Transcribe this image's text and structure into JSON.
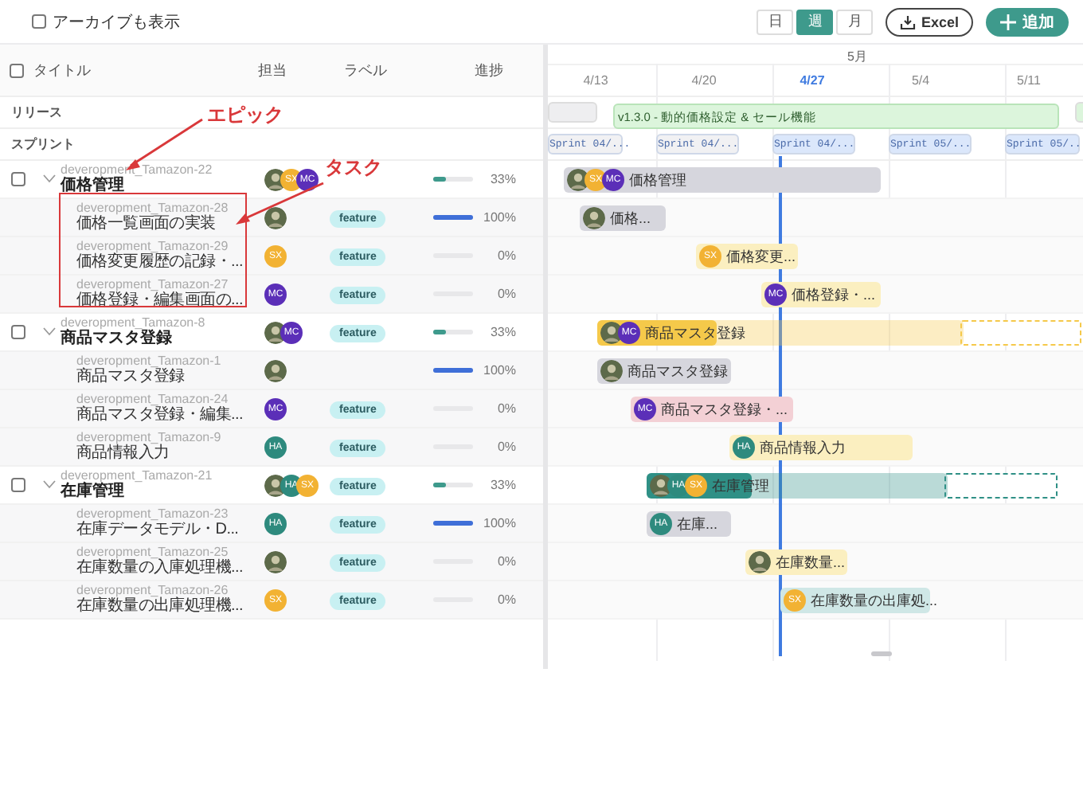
{
  "toolbar": {
    "archive_checkbox": {
      "label": "アーカイブも表示",
      "checked": false
    },
    "view_modes": [
      {
        "label": "日",
        "selected": false
      },
      {
        "label": "週",
        "selected": true
      },
      {
        "label": "月",
        "selected": false
      }
    ],
    "export_button": "Excel",
    "add_button": "追加"
  },
  "header_checkbox": {
    "checked": false
  },
  "columns": [
    "タイトル",
    "担当",
    "ラベル",
    "進捗"
  ],
  "timeline": {
    "month": "5月",
    "today_line": true,
    "weeks": [
      {
        "label": "4/13",
        "current": false
      },
      {
        "label": "4/20",
        "current": false
      },
      {
        "label": "4/27",
        "current": true
      },
      {
        "label": "5/4",
        "current": false
      },
      {
        "label": "5/11",
        "current": false
      }
    ]
  },
  "release_row": {
    "label": "リリース",
    "releases": [
      {
        "kind": "cut",
        "color": "#eeeef0"
      },
      {
        "kind": "bar",
        "label": "v1.3.0 - 動的価格設定 & セール機能",
        "color": "#dcf5dc"
      },
      {
        "kind": "cut",
        "color": "#dcf5dc"
      }
    ]
  },
  "sprint_row": {
    "label": "スプリント",
    "sprints": [
      {
        "label": "Sprint 04/...",
        "color": "#f1f1f3"
      },
      {
        "label": "Sprint 04/...",
        "color": "#f1f1f3"
      },
      {
        "label": "Sprint 04/...",
        "color": "#dbe7fb"
      },
      {
        "label": "Sprint 05/...",
        "color": "#dbe7fb"
      },
      {
        "label": "Sprint 05/...",
        "color": "#dbe7fb"
      }
    ]
  },
  "items": [
    {
      "kind": "epic",
      "id": "deveropment_Tamazon-22",
      "title": "価格管理",
      "checked": false,
      "expanded": true,
      "assignees": [
        {
          "kind": "photo"
        },
        {
          "kind": "initials",
          "text": "SX",
          "color": "#f2b233"
        },
        {
          "kind": "initials",
          "text": "MC",
          "color": "#5b2fb8"
        }
      ],
      "progress": {
        "level": 0.33,
        "reading": "33%"
      },
      "bar": {
        "label": "価格管理",
        "color": "#d6d6dd",
        "assignees": [
          {
            "kind": "photo"
          },
          {
            "kind": "initials",
            "text": "SX",
            "color": "#f2b233"
          },
          {
            "kind": "initials",
            "text": "MC",
            "color": "#5b2fb8"
          }
        ]
      },
      "children": [
        {
          "kind": "task",
          "id": "deveropment_Tamazon-28",
          "title": "価格一覧画面の実装",
          "assignees": [
            {
              "kind": "photo"
            }
          ],
          "tag": "feature",
          "progress": {
            "level": 1,
            "reading": "100%"
          },
          "bar": {
            "label": "価格...",
            "color": "#d6d6dd",
            "assignees": [
              {
                "kind": "photo"
              }
            ]
          }
        },
        {
          "kind": "task",
          "id": "deveropment_Tamazon-29",
          "title": "価格変更履歴の記録・...",
          "assignees": [
            {
              "kind": "initials",
              "text": "SX",
              "color": "#f2b233"
            }
          ],
          "tag": "feature",
          "progress": {
            "level": 0,
            "reading": "0%"
          },
          "bar": {
            "label": "価格変更...",
            "color": "#fbefc0",
            "assignees": [
              {
                "kind": "initials",
                "text": "SX",
                "color": "#f2b233"
              }
            ]
          }
        },
        {
          "kind": "task",
          "id": "deveropment_Tamazon-27",
          "title": "価格登録・編集画面の...",
          "assignees": [
            {
              "kind": "initials",
              "text": "MC",
              "color": "#5b2fb8"
            }
          ],
          "tag": "feature",
          "progress": {
            "level": 0,
            "reading": "0%"
          },
          "bar": {
            "label": "価格登録・...",
            "color": "#fbefc0",
            "assignees": [
              {
                "kind": "initials",
                "text": "MC",
                "color": "#5b2fb8"
              }
            ]
          }
        }
      ]
    },
    {
      "kind": "epic",
      "id": "deveropment_Tamazon-8",
      "title": "商品マスタ登録",
      "checked": false,
      "expanded": true,
      "assignees": [
        {
          "kind": "photo"
        },
        {
          "kind": "initials",
          "text": "MC",
          "color": "#5b2fb8"
        }
      ],
      "tag": "feature",
      "progress": {
        "level": 0.33,
        "reading": "33%"
      },
      "bar": {
        "label": "商品マスタ登録",
        "color": "#f5c94a",
        "assignees": [
          {
            "kind": "photo"
          },
          {
            "kind": "initials",
            "text": "MC",
            "color": "#5b2fb8"
          }
        ]
      },
      "children": [
        {
          "kind": "task",
          "id": "deveropment_Tamazon-1",
          "title": "商品マスタ登録",
          "assignees": [
            {
              "kind": "photo"
            }
          ],
          "progress": {
            "level": 1,
            "reading": "100%"
          },
          "bar": {
            "label": "商品マスタ登録",
            "color": "#d6d6dd",
            "assignees": [
              {
                "kind": "photo"
              }
            ]
          }
        },
        {
          "kind": "task",
          "id": "deveropment_Tamazon-24",
          "title": "商品マスタ登録・編集...",
          "assignees": [
            {
              "kind": "initials",
              "text": "MC",
              "color": "#5b2fb8"
            }
          ],
          "tag": "feature",
          "progress": {
            "level": 0,
            "reading": "0%"
          },
          "bar": {
            "label": "商品マスタ登録・...",
            "color": "#f3d0d5",
            "assignees": [
              {
                "kind": "initials",
                "text": "MC",
                "color": "#5b2fb8"
              }
            ]
          }
        },
        {
          "kind": "task",
          "id": "deveropment_Tamazon-9",
          "title": "商品情報入力",
          "assignees": [
            {
              "kind": "initials",
              "text": "HA",
              "color": "#2e8a7e"
            }
          ],
          "tag": "feature",
          "progress": {
            "level": 0,
            "reading": "0%"
          },
          "bar": {
            "label": "商品情報入力",
            "color": "#fbefc0",
            "assignees": [
              {
                "kind": "initials",
                "text": "HA",
                "color": "#2e8a7e"
              }
            ]
          }
        }
      ]
    },
    {
      "kind": "epic",
      "id": "deveropment_Tamazon-21",
      "title": "在庫管理",
      "checked": false,
      "expanded": true,
      "assignees": [
        {
          "kind": "photo"
        },
        {
          "kind": "initials",
          "text": "HA",
          "color": "#2e8a7e"
        },
        {
          "kind": "initials",
          "text": "SX",
          "color": "#f2b233"
        }
      ],
      "tag": "feature",
      "progress": {
        "level": 0.33,
        "reading": "33%"
      },
      "bar": {
        "label": "在庫管理",
        "color": "#2f9086",
        "assignees": [
          {
            "kind": "photo"
          },
          {
            "kind": "initials",
            "text": "HA",
            "color": "#2e8a7e"
          },
          {
            "kind": "initials",
            "text": "SX",
            "color": "#f2b233"
          }
        ]
      },
      "children": [
        {
          "kind": "task",
          "id": "deveropment_Tamazon-23",
          "title": "在庫データモデル・D...",
          "assignees": [
            {
              "kind": "initials",
              "text": "HA",
              "color": "#2e8a7e"
            }
          ],
          "tag": "feature",
          "progress": {
            "level": 1,
            "reading": "100%"
          },
          "bar": {
            "label": "在庫...",
            "color": "#d6d6dd",
            "assignees": [
              {
                "kind": "initials",
                "text": "HA",
                "color": "#2e8a7e"
              }
            ]
          }
        },
        {
          "kind": "task",
          "id": "deveropment_Tamazon-25",
          "title": "在庫数量の入庫処理機...",
          "assignees": [
            {
              "kind": "photo"
            }
          ],
          "tag": "feature",
          "progress": {
            "level": 0,
            "reading": "0%"
          },
          "bar": {
            "label": "在庫数量...",
            "color": "#fbefc0",
            "assignees": [
              {
                "kind": "photo"
              }
            ]
          }
        },
        {
          "kind": "task",
          "id": "deveropment_Tamazon-26",
          "title": "在庫数量の出庫処理機...",
          "assignees": [
            {
              "kind": "initials",
              "text": "SX",
              "color": "#f2b233"
            }
          ],
          "tag": "feature",
          "progress": {
            "level": 0,
            "reading": "0%"
          },
          "bar": {
            "label": "在庫数量の出庫処...",
            "color": "#cfe7e6",
            "assignees": [
              {
                "kind": "initials",
                "text": "SX",
                "color": "#f2b233"
              }
            ]
          }
        }
      ]
    }
  ],
  "annotations": [
    {
      "kind": "label",
      "text": "エピック"
    },
    {
      "kind": "label",
      "text": "タスク"
    },
    {
      "kind": "highlight_box"
    }
  ]
}
